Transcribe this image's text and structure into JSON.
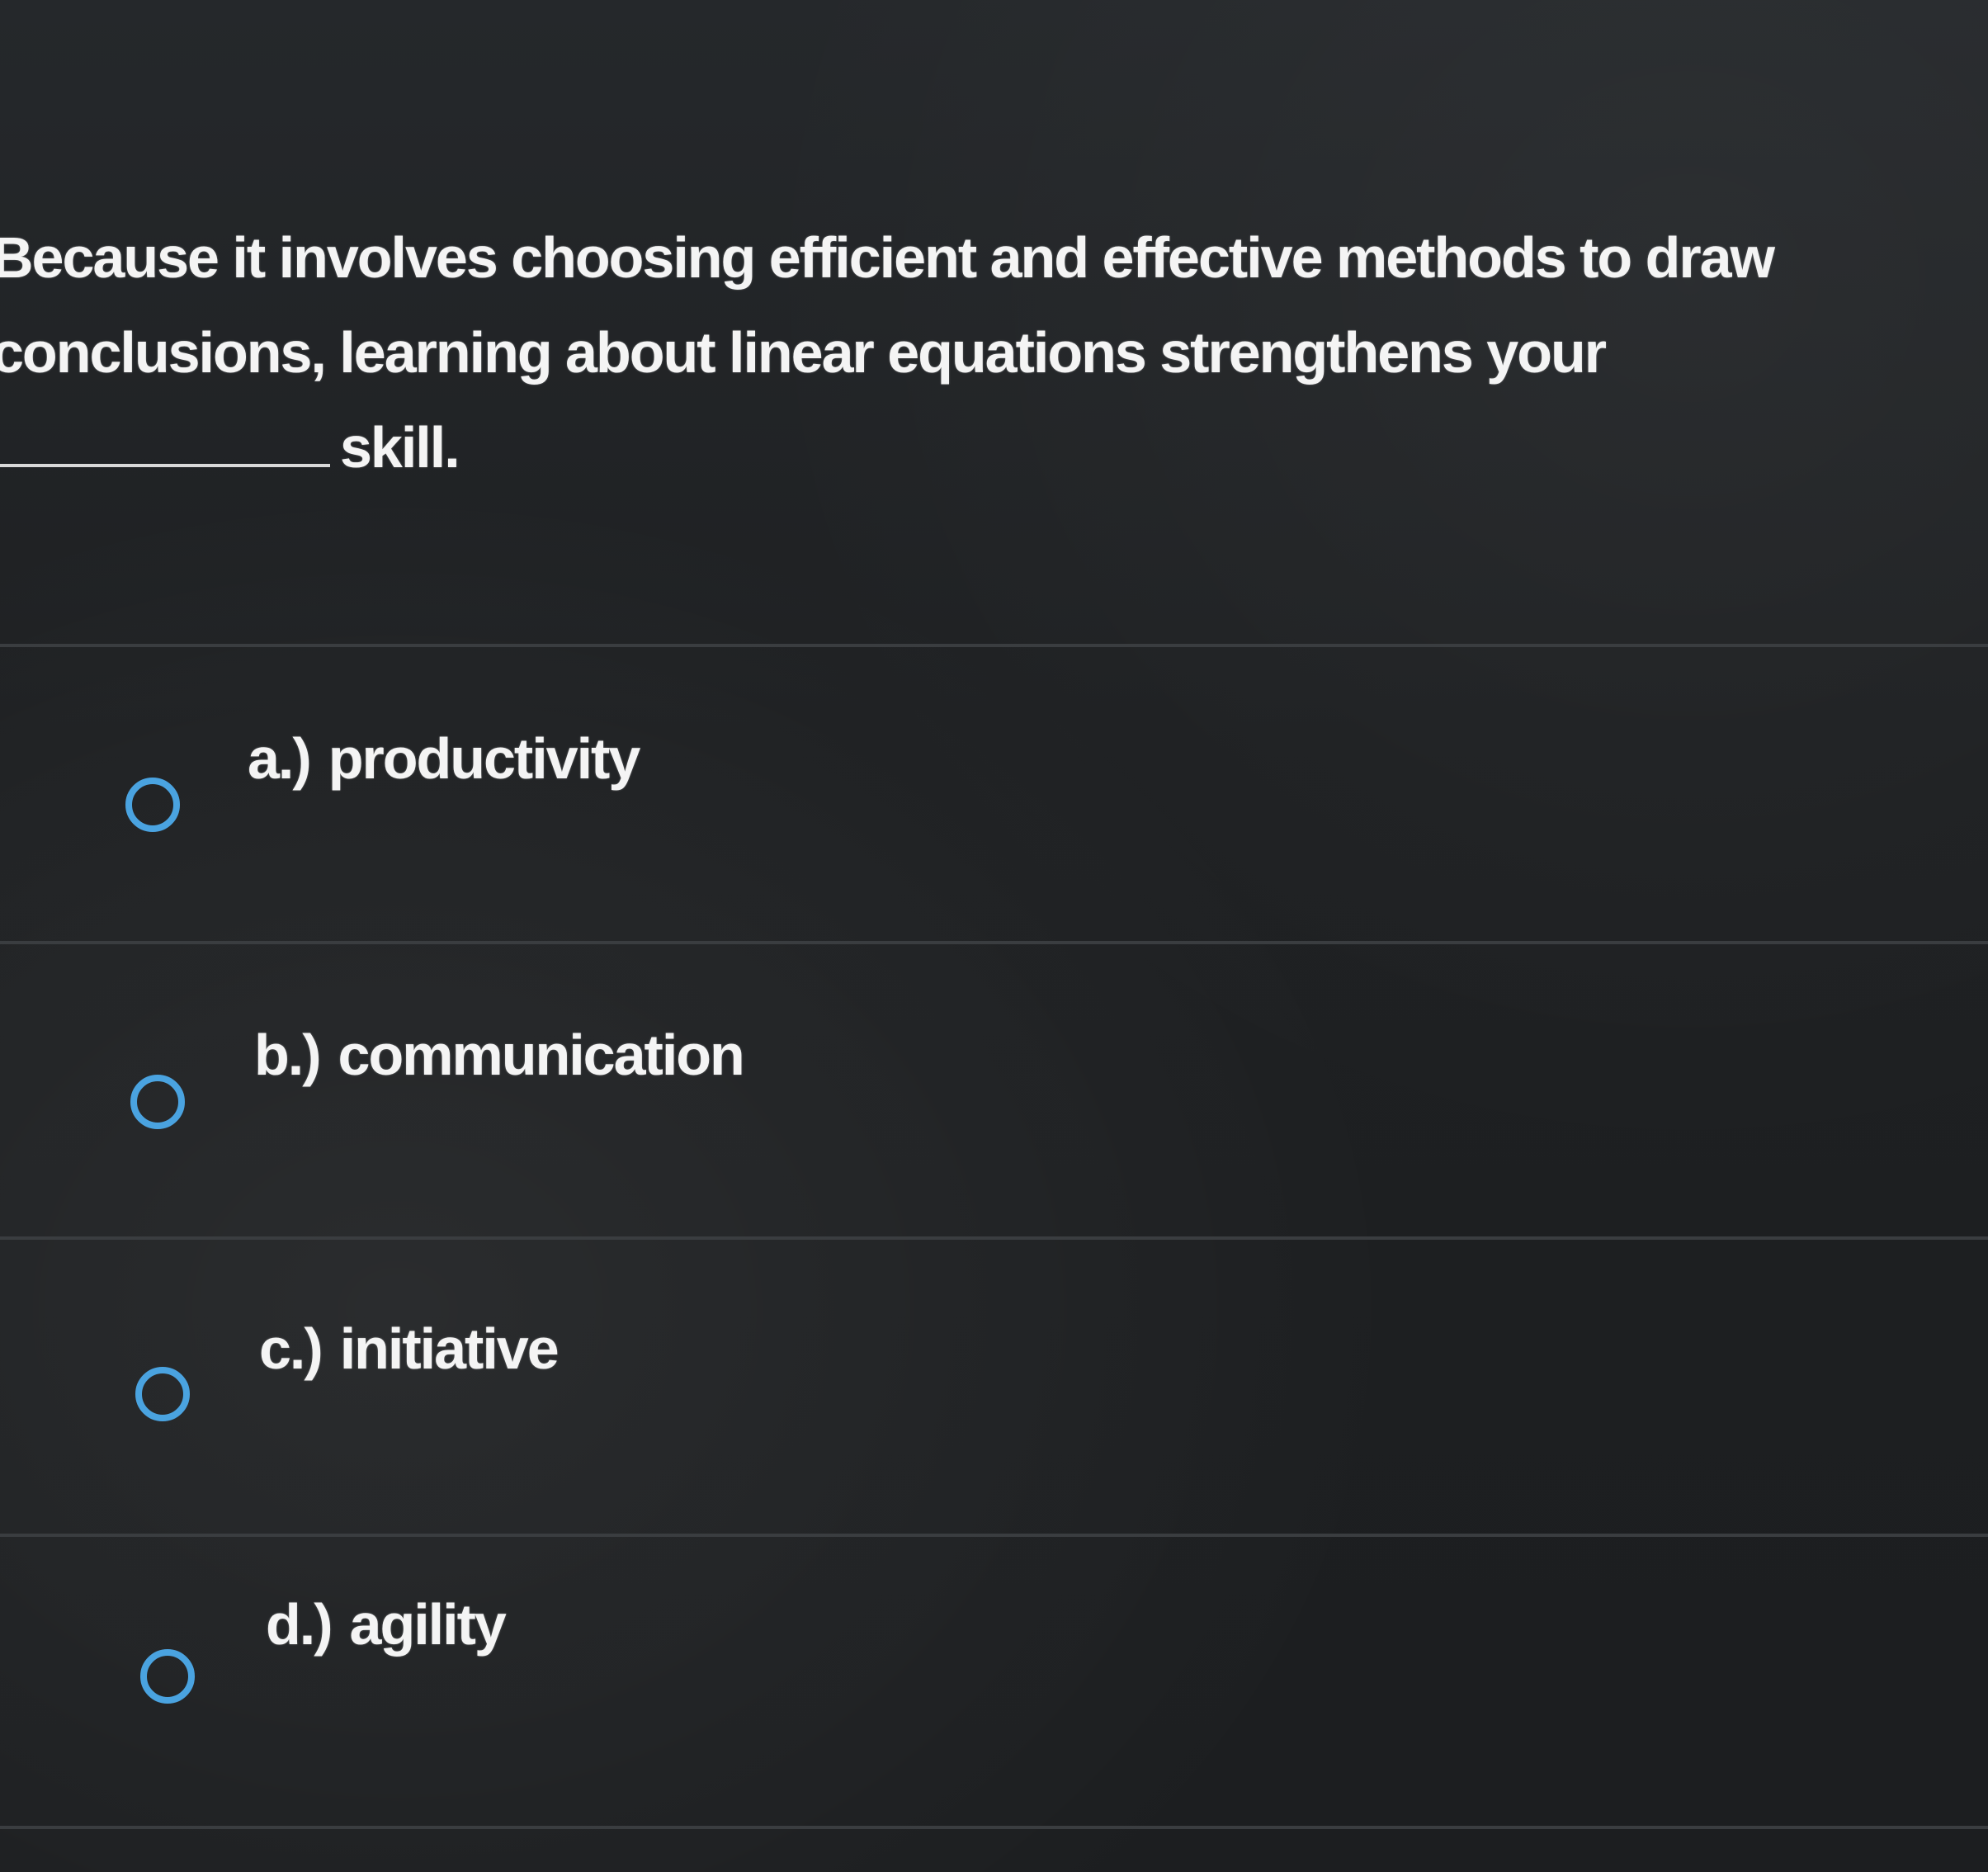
{
  "question": {
    "line1": "Because it involves choosing efficient and effective methods to draw",
    "line2": "conclusions, learning about linear equations strengthens your",
    "line3_suffix": "skill."
  },
  "options": [
    {
      "letter": "a.)",
      "label": "productivity"
    },
    {
      "letter": "b.)",
      "label": "communication"
    },
    {
      "letter": "c.)",
      "label": "initiative"
    },
    {
      "letter": "d.)",
      "label": "agility"
    }
  ],
  "colors": {
    "background": "#1f2124",
    "text": "#f4f4f4",
    "radio_accent": "#4aa3e0",
    "divider": "#3a3d40"
  }
}
